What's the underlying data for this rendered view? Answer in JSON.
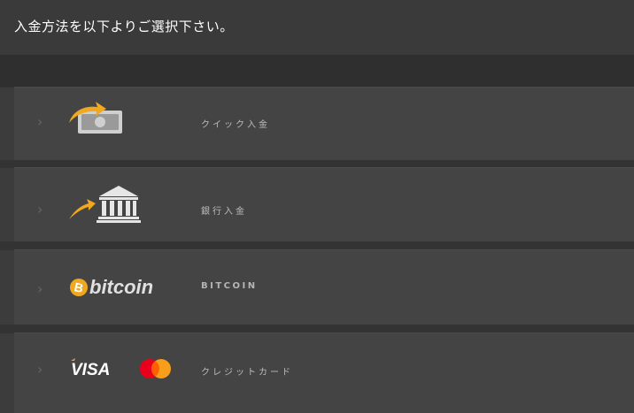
{
  "header": {
    "title": "入金方法を以下よりご選択下さい。"
  },
  "methods": [
    {
      "label": "クイック入金",
      "icon": "quick-deposit-icon"
    },
    {
      "label": "銀行入金",
      "icon": "bank-icon"
    },
    {
      "label": "BITCOIN",
      "icon": "bitcoin-logo",
      "logo_text": "bitcoin"
    },
    {
      "label": "クレジットカード",
      "icon": "visa-mastercard-logos",
      "logo_text": "VISA"
    }
  ],
  "colors": {
    "accent": "#f0a81e",
    "background": "#333333",
    "row": "#444444",
    "mastercard_red": "#eb001b",
    "mastercard_orange": "#f79e1b"
  }
}
